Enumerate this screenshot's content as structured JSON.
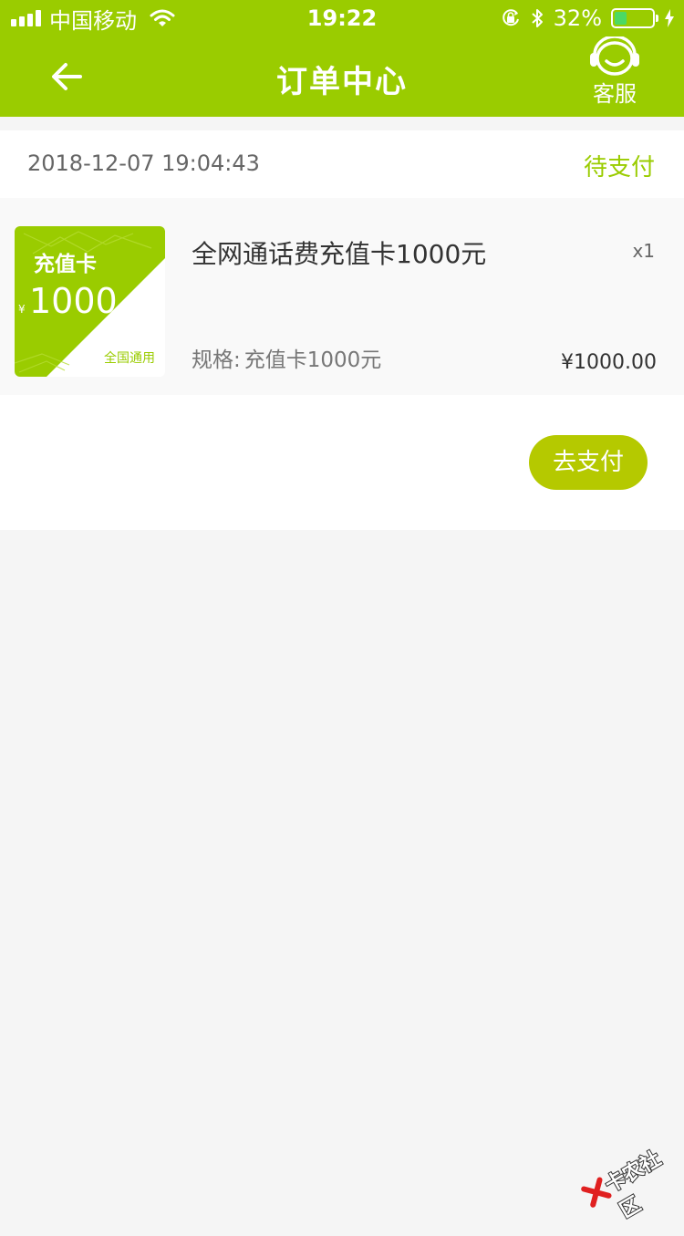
{
  "status_bar": {
    "carrier": "中国移动",
    "time": "19:22",
    "battery_percent": "32%",
    "battery_level": 0.32
  },
  "nav": {
    "title": "订单中心",
    "back_icon": "back-arrow-icon",
    "service_label": "客服",
    "service_icon": "headset-icon"
  },
  "order": {
    "time": "2018-12-07 19:04:43",
    "status": "待支付",
    "product": {
      "thumb": {
        "title": "充值卡",
        "currency": "¥",
        "amount": "1000",
        "tag": "全国通用"
      },
      "name": "全网通话费充值卡1000元",
      "qty": "x1",
      "spec_label": "规格:",
      "spec_value": "充值卡1000元",
      "price": "¥1000.00"
    },
    "pay_button": "去支付"
  },
  "watermark": {
    "text": "卡农社区"
  },
  "colors": {
    "brand": "#9acc00",
    "button": "#b5c900",
    "background": "#f5f5f5"
  }
}
